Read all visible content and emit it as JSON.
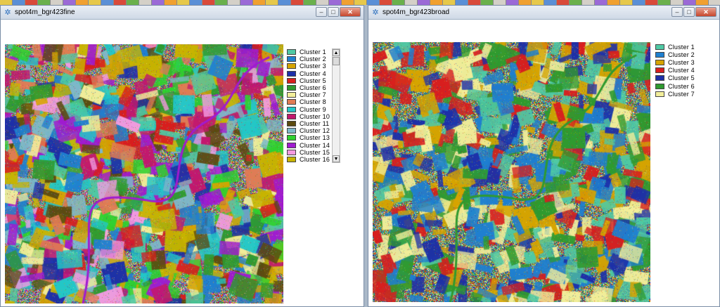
{
  "toolbar": {
    "button_count": 56
  },
  "windows": [
    {
      "id": "left",
      "title": "spot4m_bgr423fine",
      "controls": {
        "minimize": "–",
        "maximize": "□",
        "close": "✕"
      },
      "legend": [
        {
          "label": "Cluster  1",
          "color": "#4fc9a4"
        },
        {
          "label": "Cluster  2",
          "color": "#1f7fd0"
        },
        {
          "label": "Cluster  3",
          "color": "#d6a400"
        },
        {
          "label": "Cluster  4",
          "color": "#1d2fa8"
        },
        {
          "label": "Cluster  5",
          "color": "#d81e1e"
        },
        {
          "label": "Cluster  6",
          "color": "#2f9a2f"
        },
        {
          "label": "Cluster  7",
          "color": "#f2ee9a"
        },
        {
          "label": "Cluster  8",
          "color": "#e07b55"
        },
        {
          "label": "Cluster  9",
          "color": "#22c7c7"
        },
        {
          "label": "Cluster  10",
          "color": "#c2186e"
        },
        {
          "label": "Cluster  11",
          "color": "#5b4a10"
        },
        {
          "label": "Cluster  12",
          "color": "#7db8c9"
        },
        {
          "label": "Cluster  13",
          "color": "#2fd12f"
        },
        {
          "label": "Cluster  14",
          "color": "#a01bd0"
        },
        {
          "label": "Cluster  15",
          "color": "#f49ae0"
        },
        {
          "label": "Cluster  16",
          "color": "#c8b400"
        }
      ],
      "scroll": {
        "up": "▲",
        "down": "▼"
      }
    },
    {
      "id": "right",
      "title": "spot4m_bgr423broad",
      "controls": {
        "minimize": "–",
        "maximize": "□",
        "close": "✕"
      },
      "legend": [
        {
          "label": "Cluster  1",
          "color": "#4fc9a4"
        },
        {
          "label": "Cluster  2",
          "color": "#1f7fd0"
        },
        {
          "label": "Cluster  3",
          "color": "#d6a400"
        },
        {
          "label": "Cluster  4",
          "color": "#d81e1e"
        },
        {
          "label": "Cluster  5",
          "color": "#1d2fa8"
        },
        {
          "label": "Cluster  6",
          "color": "#2f9a2f"
        },
        {
          "label": "Cluster  7",
          "color": "#f2ee9a"
        }
      ]
    }
  ]
}
